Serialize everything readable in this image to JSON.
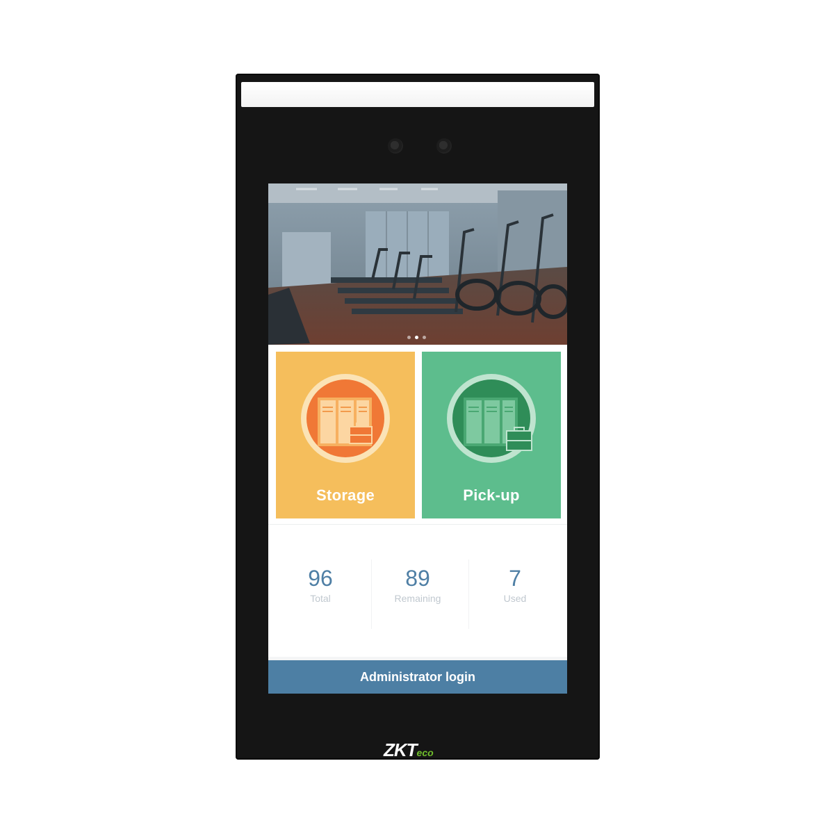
{
  "banner": {
    "image": "gym-treadmills-photo",
    "carousel_dots": 3,
    "active_dot": 1
  },
  "tiles": {
    "storage": {
      "label": "Storage",
      "icon": "locker-storage-icon",
      "color": "#f5be5c"
    },
    "pickup": {
      "label": "Pick-up",
      "icon": "locker-pickup-icon",
      "color": "#5dbd8d"
    }
  },
  "stats": {
    "total": {
      "value": "96",
      "label": "Total"
    },
    "remaining": {
      "value": "89",
      "label": "Remaining"
    },
    "used": {
      "value": "7",
      "label": "Used"
    }
  },
  "admin": {
    "label": "Administrator login",
    "color": "#4d7fa4"
  },
  "brand": {
    "prefix": "ZKT",
    "suffix": "eco"
  }
}
